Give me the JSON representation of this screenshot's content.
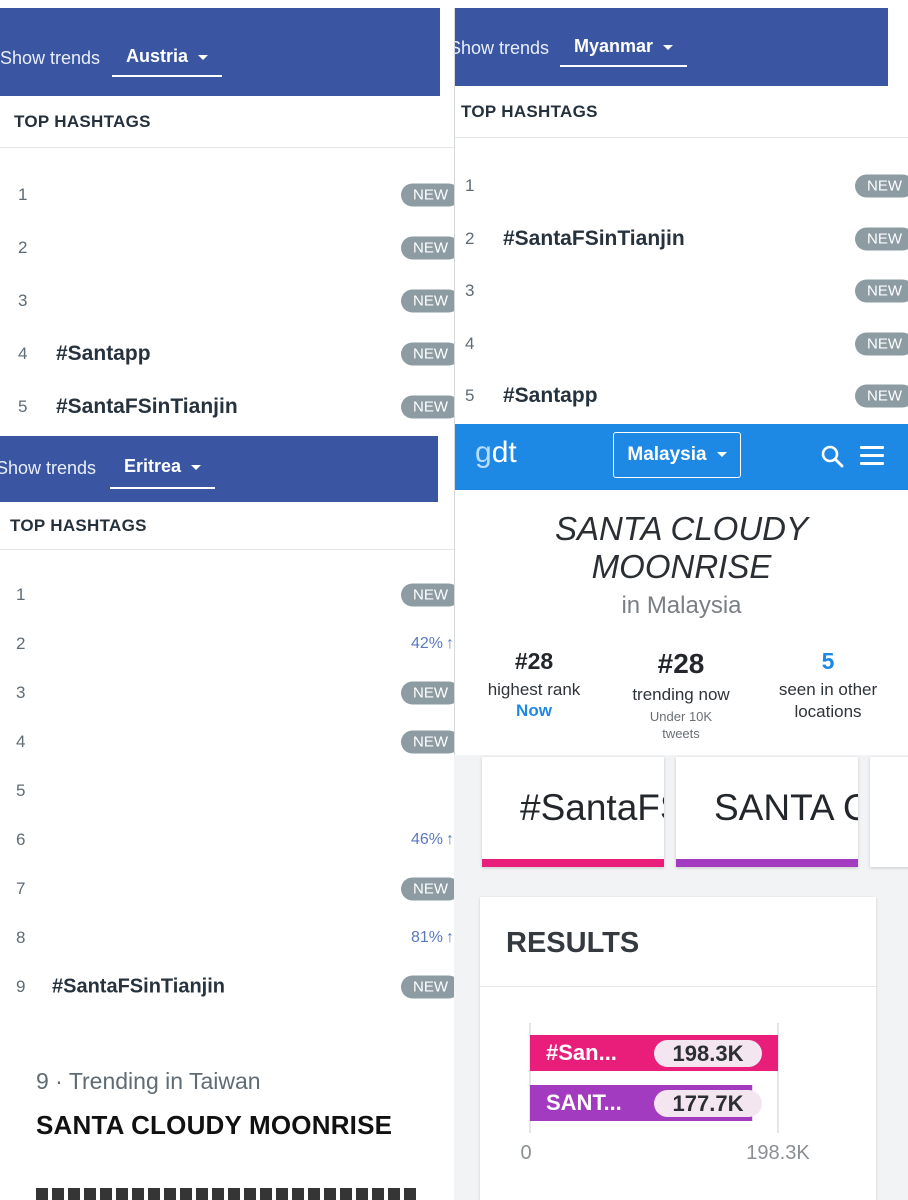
{
  "austria": {
    "show_trends_label": "Show trends",
    "country": "Austria",
    "section_title": "TOP HASHTAGS",
    "rows": [
      {
        "rank": "1",
        "tag": "",
        "badge": "NEW"
      },
      {
        "rank": "2",
        "tag": "",
        "badge": "NEW"
      },
      {
        "rank": "3",
        "tag": "",
        "badge": "NEW"
      },
      {
        "rank": "4",
        "tag": "#Santapp",
        "badge": "NEW"
      },
      {
        "rank": "5",
        "tag": "#SantaFSinTianjin",
        "badge": "NEW"
      }
    ]
  },
  "myanmar": {
    "show_trends_label": "Show trends",
    "country": "Myanmar",
    "section_title": "TOP HASHTAGS",
    "rows": [
      {
        "rank": "1",
        "tag": "",
        "badge": "NEW"
      },
      {
        "rank": "2",
        "tag": "#SantaFSinTianjin",
        "badge": "NEW"
      },
      {
        "rank": "3",
        "tag": "",
        "badge": "NEW"
      },
      {
        "rank": "4",
        "tag": "",
        "badge": "NEW"
      },
      {
        "rank": "5",
        "tag": "#Santapp",
        "badge": "NEW"
      }
    ]
  },
  "eritrea": {
    "show_trends_label": "Show trends",
    "country": "Eritrea",
    "section_title": "TOP HASHTAGS",
    "rows": [
      {
        "rank": "1",
        "tag": "",
        "badge": "NEW",
        "pct": ""
      },
      {
        "rank": "2",
        "tag": "",
        "badge": "",
        "pct": "42%"
      },
      {
        "rank": "3",
        "tag": "",
        "badge": "NEW",
        "pct": ""
      },
      {
        "rank": "4",
        "tag": "",
        "badge": "NEW",
        "pct": ""
      },
      {
        "rank": "5",
        "tag": "",
        "badge": "",
        "pct": ""
      },
      {
        "rank": "6",
        "tag": "",
        "badge": "",
        "pct": "46%"
      },
      {
        "rank": "7",
        "tag": "",
        "badge": "NEW",
        "pct": ""
      },
      {
        "rank": "8",
        "tag": "",
        "badge": "",
        "pct": "81%"
      },
      {
        "rank": "9",
        "tag": "#SantaFSinTianjin",
        "badge": "NEW",
        "pct": ""
      }
    ]
  },
  "gdt": {
    "logo_g": "g",
    "logo_dt": "dt",
    "country_button": "Malaysia",
    "trend_title": "SANTA CLOUDY MOONRISE",
    "trend_location": "in Malaysia",
    "stats": {
      "highest_rank": "#28",
      "highest_rank_label": "highest rank",
      "highest_rank_when": "Now",
      "trending_now": "#28",
      "trending_now_label": "trending now",
      "trending_now_sub": "Under 10K tweets",
      "other_locations": "5",
      "other_locations_label": "seen in other locations"
    },
    "cards": [
      {
        "text": "#SantaFS",
        "color": "#e91e7a"
      },
      {
        "text": "SANTA C",
        "color": "#a23bbf"
      }
    ],
    "results_title": "RESULTS",
    "colors": {
      "primary": "#1e88e5",
      "pink": "#e91e7a",
      "purple": "#a23bbf"
    }
  },
  "chart_data": {
    "type": "bar",
    "orientation": "horizontal",
    "categories": [
      "#San...",
      "SANT..."
    ],
    "values": [
      198300,
      177700
    ],
    "value_labels": [
      "198.3K",
      "177.7K"
    ],
    "colors": [
      "#e91e7a",
      "#a23bbf"
    ],
    "xlim": [
      0,
      198300
    ],
    "tick_labels": [
      "0",
      "198.3K"
    ],
    "title": "",
    "xlabel": "",
    "ylabel": ""
  },
  "taiwan": {
    "label": "9 · Trending in Taiwan",
    "title": "SANTA CLOUDY MOONRISE"
  }
}
